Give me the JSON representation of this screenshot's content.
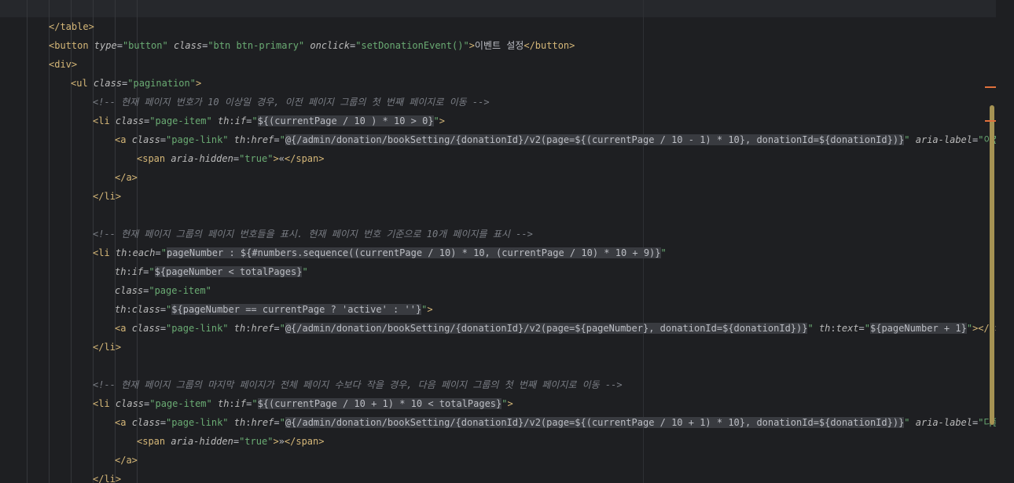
{
  "editor": {
    "language": "html-thymeleaf",
    "colors": {
      "background": "#1e1f22",
      "tag": "#d5b778",
      "attribute": "#bababa",
      "value": "#6aab73",
      "comment": "#7a7e85",
      "text": "#bcbec4",
      "scroll_thumb": "#a59253",
      "marker": "#e0703c"
    },
    "lines": [
      {
        "indent": 1,
        "tokens": [
          {
            "c": "tg",
            "t": "</table>"
          }
        ]
      },
      {
        "indent": 1,
        "tokens": [
          {
            "c": "tg",
            "t": "<button "
          },
          {
            "c": "at",
            "t": "type"
          },
          {
            "c": "pu",
            "t": "="
          },
          {
            "c": "vl",
            "t": "\"button\" "
          },
          {
            "c": "at",
            "t": "class"
          },
          {
            "c": "pu",
            "t": "="
          },
          {
            "c": "vl",
            "t": "\"btn btn-primary\" "
          },
          {
            "c": "at",
            "t": "onclick"
          },
          {
            "c": "pu",
            "t": "="
          },
          {
            "c": "vl",
            "t": "\"setDonationEvent()\""
          },
          {
            "c": "tg",
            "t": ">"
          },
          {
            "c": "tx",
            "t": "이벤트 설정"
          },
          {
            "c": "tg",
            "t": "</button>"
          }
        ]
      },
      {
        "indent": 1,
        "tokens": [
          {
            "c": "tg",
            "t": "<div>"
          }
        ]
      },
      {
        "indent": 2,
        "tokens": [
          {
            "c": "tg",
            "t": "<ul "
          },
          {
            "c": "at",
            "t": "class"
          },
          {
            "c": "pu",
            "t": "="
          },
          {
            "c": "vl",
            "t": "\"pagination\""
          },
          {
            "c": "tg",
            "t": ">"
          }
        ]
      },
      {
        "indent": 3,
        "tokens": [
          {
            "c": "cm",
            "t": "<!-- 현재 페이지 번호가 10 이상일 경우, 이전 페이지 그룹의 첫 번째 페이지로 이동 -->"
          }
        ]
      },
      {
        "indent": 3,
        "tokens": [
          {
            "c": "tg",
            "t": "<li "
          },
          {
            "c": "at",
            "t": "class"
          },
          {
            "c": "pu",
            "t": "="
          },
          {
            "c": "vl",
            "t": "\"page-item\" "
          },
          {
            "c": "ns",
            "t": "th"
          },
          {
            "c": "pu",
            "t": ":"
          },
          {
            "c": "at",
            "t": "if"
          },
          {
            "c": "pu",
            "t": "="
          },
          {
            "c": "vl",
            "t": "\""
          },
          {
            "c": "exs",
            "t": "${(currentPage / 10 ) * 10 > 0}"
          },
          {
            "c": "vl",
            "t": "\""
          },
          {
            "c": "tg",
            "t": ">"
          }
        ]
      },
      {
        "indent": 4,
        "tokens": [
          {
            "c": "tg",
            "t": "<a "
          },
          {
            "c": "at",
            "t": "class"
          },
          {
            "c": "pu",
            "t": "="
          },
          {
            "c": "vl",
            "t": "\"page-link\" "
          },
          {
            "c": "ns",
            "t": "th"
          },
          {
            "c": "pu",
            "t": ":"
          },
          {
            "c": "at",
            "t": "href"
          },
          {
            "c": "pu",
            "t": "="
          },
          {
            "c": "vl",
            "t": "\""
          },
          {
            "c": "exs",
            "t": "@{/admin/donation/bookSetting/{donationId}/v2(page=${(currentPage / 10 - 1) * 10}, donationId=${donationId})}"
          },
          {
            "c": "vl",
            "t": "\" "
          },
          {
            "c": "at",
            "t": "aria-label"
          },
          {
            "c": "pu",
            "t": "="
          },
          {
            "c": "vl",
            "t": "\"이전 페이지\""
          }
        ]
      },
      {
        "indent": 5,
        "tokens": [
          {
            "c": "tg",
            "t": "<span "
          },
          {
            "c": "at",
            "t": "aria-hidden"
          },
          {
            "c": "pu",
            "t": "="
          },
          {
            "c": "vl",
            "t": "\"true\""
          },
          {
            "c": "tg",
            "t": ">"
          },
          {
            "c": "tx",
            "t": "«"
          },
          {
            "c": "tg",
            "t": "</span>"
          }
        ]
      },
      {
        "indent": 4,
        "tokens": [
          {
            "c": "tg",
            "t": "</a>"
          }
        ]
      },
      {
        "indent": 3,
        "tokens": [
          {
            "c": "tg",
            "t": "</li>"
          }
        ]
      },
      {
        "indent": 3,
        "tokens": []
      },
      {
        "indent": 3,
        "tokens": [
          {
            "c": "cm",
            "t": "<!-- 현재 페이지 그룹의 페이지 번호들을 표시. 현재 페이지 번호 기준으로 10개 페이지를 표시 -->"
          }
        ]
      },
      {
        "indent": 3,
        "tokens": [
          {
            "c": "tg",
            "t": "<li "
          },
          {
            "c": "ns",
            "t": "th"
          },
          {
            "c": "pu",
            "t": ":"
          },
          {
            "c": "at",
            "t": "each"
          },
          {
            "c": "pu",
            "t": "="
          },
          {
            "c": "vl",
            "t": "\""
          },
          {
            "c": "exs",
            "t": "pageNumber : ${#numbers.sequence((currentPage / 10) * 10, (currentPage / 10) * 10 + 9)}"
          },
          {
            "c": "vl",
            "t": "\""
          }
        ]
      },
      {
        "indent": 4,
        "tokens": [
          {
            "c": "ns",
            "t": "th"
          },
          {
            "c": "pu",
            "t": ":"
          },
          {
            "c": "at",
            "t": "if"
          },
          {
            "c": "pu",
            "t": "="
          },
          {
            "c": "vl",
            "t": "\""
          },
          {
            "c": "exs",
            "t": "${pageNumber < totalPages}"
          },
          {
            "c": "vl",
            "t": "\""
          }
        ]
      },
      {
        "indent": 4,
        "tokens": [
          {
            "c": "at",
            "t": "class"
          },
          {
            "c": "pu",
            "t": "="
          },
          {
            "c": "vl",
            "t": "\"page-item\""
          }
        ]
      },
      {
        "indent": 4,
        "tokens": [
          {
            "c": "ns",
            "t": "th"
          },
          {
            "c": "pu",
            "t": ":"
          },
          {
            "c": "at",
            "t": "class"
          },
          {
            "c": "pu",
            "t": "="
          },
          {
            "c": "vl",
            "t": "\""
          },
          {
            "c": "exs",
            "t": "${pageNumber == currentPage ? 'active' : ''}"
          },
          {
            "c": "vl",
            "t": "\""
          },
          {
            "c": "tg",
            "t": ">"
          }
        ]
      },
      {
        "indent": 4,
        "tokens": [
          {
            "c": "tg",
            "t": "<a "
          },
          {
            "c": "at",
            "t": "class"
          },
          {
            "c": "pu",
            "t": "="
          },
          {
            "c": "vl",
            "t": "\"page-link\" "
          },
          {
            "c": "ns",
            "t": "th"
          },
          {
            "c": "pu",
            "t": ":"
          },
          {
            "c": "at",
            "t": "href"
          },
          {
            "c": "pu",
            "t": "="
          },
          {
            "c": "vl",
            "t": "\""
          },
          {
            "c": "exs",
            "t": "@{/admin/donation/bookSetting/{donationId}/v2(page=${pageNumber}, donationId=${donationId})}"
          },
          {
            "c": "vl",
            "t": "\" "
          },
          {
            "c": "ns",
            "t": "th"
          },
          {
            "c": "pu",
            "t": ":"
          },
          {
            "c": "at",
            "t": "text"
          },
          {
            "c": "pu",
            "t": "="
          },
          {
            "c": "vl",
            "t": "\""
          },
          {
            "c": "exs",
            "t": "${pageNumber + 1}"
          },
          {
            "c": "vl",
            "t": "\""
          },
          {
            "c": "tg",
            "t": "></a>"
          }
        ]
      },
      {
        "indent": 3,
        "tokens": [
          {
            "c": "tg",
            "t": "</li>"
          }
        ]
      },
      {
        "indent": 3,
        "tokens": []
      },
      {
        "indent": 3,
        "tokens": [
          {
            "c": "cm",
            "t": "<!-- 현재 페이지 그룹의 마지막 페이지가 전체 페이지 수보다 작을 경우, 다음 페이지 그룹의 첫 번째 페이지로 이동 -->"
          }
        ]
      },
      {
        "indent": 3,
        "tokens": [
          {
            "c": "tg",
            "t": "<li "
          },
          {
            "c": "at",
            "t": "class"
          },
          {
            "c": "pu",
            "t": "="
          },
          {
            "c": "vl",
            "t": "\"page-item\" "
          },
          {
            "c": "ns",
            "t": "th"
          },
          {
            "c": "pu",
            "t": ":"
          },
          {
            "c": "at",
            "t": "if"
          },
          {
            "c": "pu",
            "t": "="
          },
          {
            "c": "vl",
            "t": "\""
          },
          {
            "c": "exs",
            "t": "${(currentPage / 10 + 1) * 10 < totalPages}"
          },
          {
            "c": "vl",
            "t": "\""
          },
          {
            "c": "tg",
            "t": ">"
          }
        ]
      },
      {
        "indent": 4,
        "tokens": [
          {
            "c": "tg",
            "t": "<a "
          },
          {
            "c": "at",
            "t": "class"
          },
          {
            "c": "pu",
            "t": "="
          },
          {
            "c": "vl",
            "t": "\"page-link\" "
          },
          {
            "c": "ns",
            "t": "th"
          },
          {
            "c": "pu",
            "t": ":"
          },
          {
            "c": "at",
            "t": "href"
          },
          {
            "c": "pu",
            "t": "="
          },
          {
            "c": "vl",
            "t": "\""
          },
          {
            "c": "exs",
            "t": "@{/admin/donation/bookSetting/{donationId}/v2(page=${(currentPage / 10 + 1) * 10}, donationId=${donationId})}"
          },
          {
            "c": "vl",
            "t": "\" "
          },
          {
            "c": "at",
            "t": "aria-label"
          },
          {
            "c": "pu",
            "t": "="
          },
          {
            "c": "vl",
            "t": "\"다음 페이지\""
          }
        ]
      },
      {
        "indent": 5,
        "tokens": [
          {
            "c": "tg",
            "t": "<span "
          },
          {
            "c": "at",
            "t": "aria-hidden"
          },
          {
            "c": "pu",
            "t": "="
          },
          {
            "c": "vl",
            "t": "\"true\""
          },
          {
            "c": "tg",
            "t": ">"
          },
          {
            "c": "tx",
            "t": "»"
          },
          {
            "c": "tg",
            "t": "</span>"
          }
        ]
      },
      {
        "indent": 4,
        "tokens": [
          {
            "c": "tg",
            "t": "</a>"
          }
        ]
      },
      {
        "indent": 3,
        "tokens": [
          {
            "c": "tg",
            "t": "</li>"
          }
        ]
      }
    ]
  }
}
